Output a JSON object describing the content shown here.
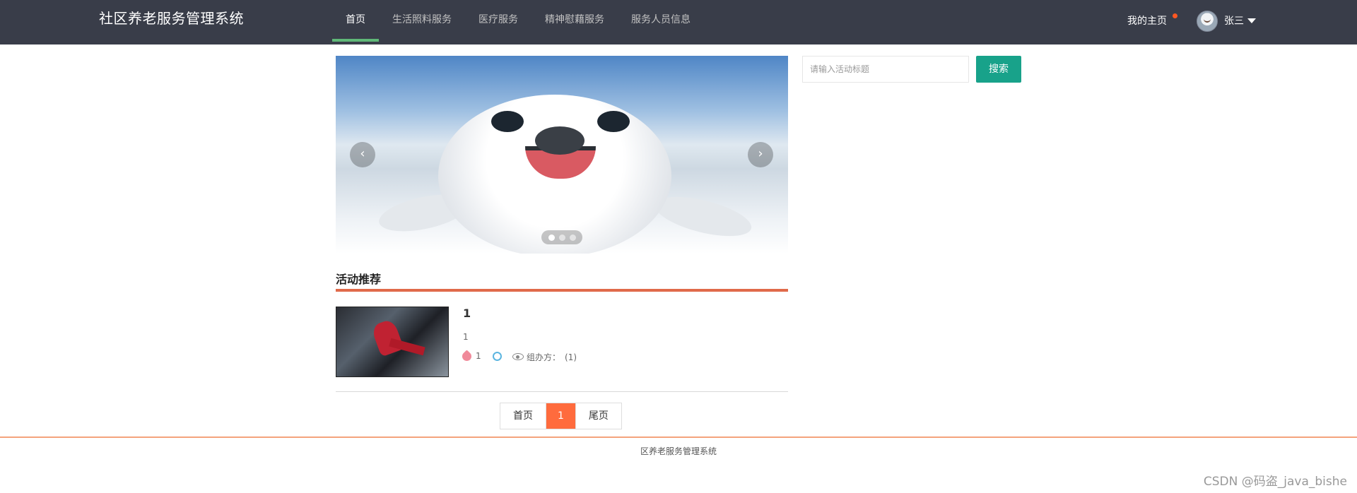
{
  "header": {
    "brand": "社区养老服务管理系统",
    "nav": [
      "首页",
      "生活照料服务",
      "医疗服务",
      "精神慰藉服务",
      "服务人员信息"
    ],
    "home_link": "我的主页",
    "user_name": "张三"
  },
  "carousel": {
    "prev_icon": "‹",
    "next_icon": "›",
    "slides": 3,
    "active_slide": 1
  },
  "search": {
    "placeholder": "请输入活动标题",
    "button_label": "搜索",
    "button_color": "#18a28a"
  },
  "activities": {
    "section_title": "活动推荐",
    "items": [
      {
        "title": "1",
        "description": "1",
        "tag_count": "1",
        "organizer_label": "组办方：",
        "organizer_value": "(1)"
      }
    ]
  },
  "pagination": {
    "first": "首页",
    "current": "1",
    "last": "尾页",
    "accent": "#ff6b3d"
  },
  "footer": {
    "text": "区养老服务管理系统",
    "watermark": "CSDN @码盗_java_bishe"
  }
}
